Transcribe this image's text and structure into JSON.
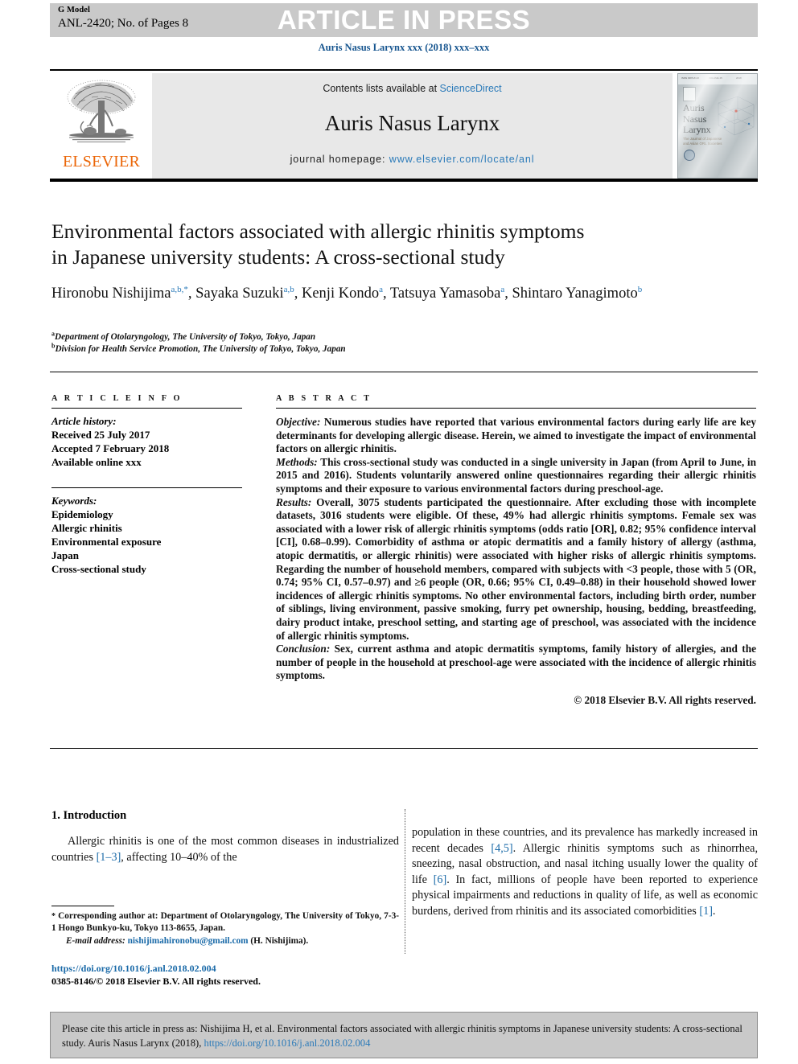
{
  "header": {
    "g_model_label": "G Model",
    "manuscript_id": "ANL-2420; No. of Pages 8",
    "press_banner": "ARTICLE IN PRESS",
    "journal_citation": "Auris Nasus Larynx xxx (2018) xxx–xxx"
  },
  "masthead": {
    "contents_prefix": "Contents lists available at",
    "sciencedirect": "ScienceDirect",
    "journal_name": "Auris Nasus Larynx",
    "homepage_prefix": "journal homepage:",
    "homepage_url": "www.elsevier.com/locate/anl",
    "publisher_logo_text": "ELSEVIER",
    "cover": {
      "title_line1": "Auris",
      "title_line2": "Nasus",
      "title_line3": "Larynx",
      "subtitle": "The Journal of Japanese\nand Asian ORL Societies"
    }
  },
  "article": {
    "title_line1": "Environmental factors associated with allergic rhinitis symptoms",
    "title_line2": "in Japanese university students: A cross-sectional study",
    "authors": [
      {
        "name": "Hironobu Nishijima",
        "marks": "a,b,*"
      },
      {
        "name": "Sayaka Suzuki",
        "marks": "a,b"
      },
      {
        "name": "Kenji Kondo",
        "marks": "a"
      },
      {
        "name": "Tatsuya Yamasoba",
        "marks": "a"
      },
      {
        "name": "Shintaro Yanagimoto",
        "marks": "b"
      }
    ],
    "affiliations": [
      {
        "mark": "a",
        "text": "Department of Otolaryngology, The University of Tokyo, Tokyo, Japan"
      },
      {
        "mark": "b",
        "text": "Division for Health Service Promotion, The University of Tokyo, Tokyo, Japan"
      }
    ]
  },
  "article_info": {
    "heading": "A R T I C L E  I N F O",
    "history_heading": "Article history:",
    "history": [
      "Received 25 July 2017",
      "Accepted 7 February 2018",
      "Available online xxx"
    ],
    "keywords_heading": "Keywords:",
    "keywords": [
      "Epidemiology",
      "Allergic rhinitis",
      "Environmental exposure",
      "Japan",
      "Cross-sectional study"
    ]
  },
  "abstract": {
    "heading": "A B S T R A C T",
    "objective_label": "Objective:",
    "objective_text": " Numerous studies have reported that various environmental factors during early life are key determinants for developing allergic disease. Herein, we aimed to investigate the impact of environmental factors on allergic rhinitis.",
    "methods_label": "Methods:",
    "methods_text": " This cross-sectional study was conducted in a single university in Japan (from April to June, in 2015 and 2016). Students voluntarily answered online questionnaires regarding their allergic rhinitis symptoms and their exposure to various environmental factors during preschool-age.",
    "results_label": "Results:",
    "results_text": " Overall, 3075 students participated the questionnaire. After excluding those with incomplete datasets, 3016 students were eligible. Of these, 49% had allergic rhinitis symptoms. Female sex was associated with a lower risk of allergic rhinitis symptoms (odds ratio [OR], 0.82; 95% confidence interval [CI], 0.68–0.99). Comorbidity of asthma or atopic dermatitis and a family history of allergy (asthma, atopic dermatitis, or allergic rhinitis) were associated with higher risks of allergic rhinitis symptoms. Regarding the number of household members, compared with subjects with <3 people, those with 5 (OR, 0.74; 95% CI, 0.57–0.97) and ≥6 people (OR, 0.66; 95% CI, 0.49–0.88) in their household showed lower incidences of allergic rhinitis symptoms. No other environmental factors, including birth order, number of siblings, living environment, passive smoking, furry pet ownership, housing, bedding, breastfeeding, dairy product intake, preschool setting, and starting age of preschool, was associated with the incidence of allergic rhinitis symptoms.",
    "conclusion_label": "Conclusion:",
    "conclusion_text": " Sex, current asthma and atopic dermatitis symptoms, family history of allergies, and the number of people in the household at preschool-age were associated with the incidence of allergic rhinitis symptoms.",
    "copyright": "© 2018 Elsevier B.V. All rights reserved."
  },
  "body": {
    "intro_heading": "1.  Introduction",
    "intro_part1_a": "Allergic rhinitis is one of the most common diseases in industrialized countries ",
    "intro_ref_1_3": "[1–3]",
    "intro_part1_b": ", affecting 10–40% of the",
    "intro_part2_a": "population in these countries, and its prevalence has markedly increased in recent decades ",
    "intro_ref_4_5": "[4,5]",
    "intro_part2_b": ". Allergic rhinitis symptoms such as rhinorrhea, sneezing, nasal obstruction, and nasal itching usually lower the quality of life ",
    "intro_ref_6": "[6]",
    "intro_part2_c": ". In fact, millions of people have been reported to experience physical impairments and reductions in quality of life, as well as economic burdens, derived from rhinitis and its associated comorbidities ",
    "intro_ref_1": "[1]",
    "intro_part2_d": "."
  },
  "footnote": {
    "star": "*",
    "corresponding": " Corresponding author at: Department of Otolaryngology, The University of Tokyo, 7-3-1 Hongo Bunkyo-ku, Tokyo 113-8655, Japan.",
    "email_label": "E-mail address:",
    "email": "nishijimahironobu@gmail.com",
    "email_suffix": " (H. Nishijima).",
    "doi_url": "https://doi.org/10.1016/j.anl.2018.02.004",
    "issn_line": "0385-8146/© 2018 Elsevier B.V. All rights reserved."
  },
  "cite_box": {
    "text_before_link": "Please cite this article in press as: Nishijima H, et al. Environmental factors associated with allergic rhinitis symptoms in Japanese university students: A cross-sectional study. Auris Nasus Larynx (2018), ",
    "link": "https://doi.org/10.1016/j.anl.2018.02.004"
  },
  "colors": {
    "accent_blue": "#1a6aa8",
    "link_blue": "#2a7ab9",
    "elsevier_orange": "#eb6608",
    "banner_grey": "#c9c9c9",
    "masthead_grey": "#e8e8e8"
  }
}
